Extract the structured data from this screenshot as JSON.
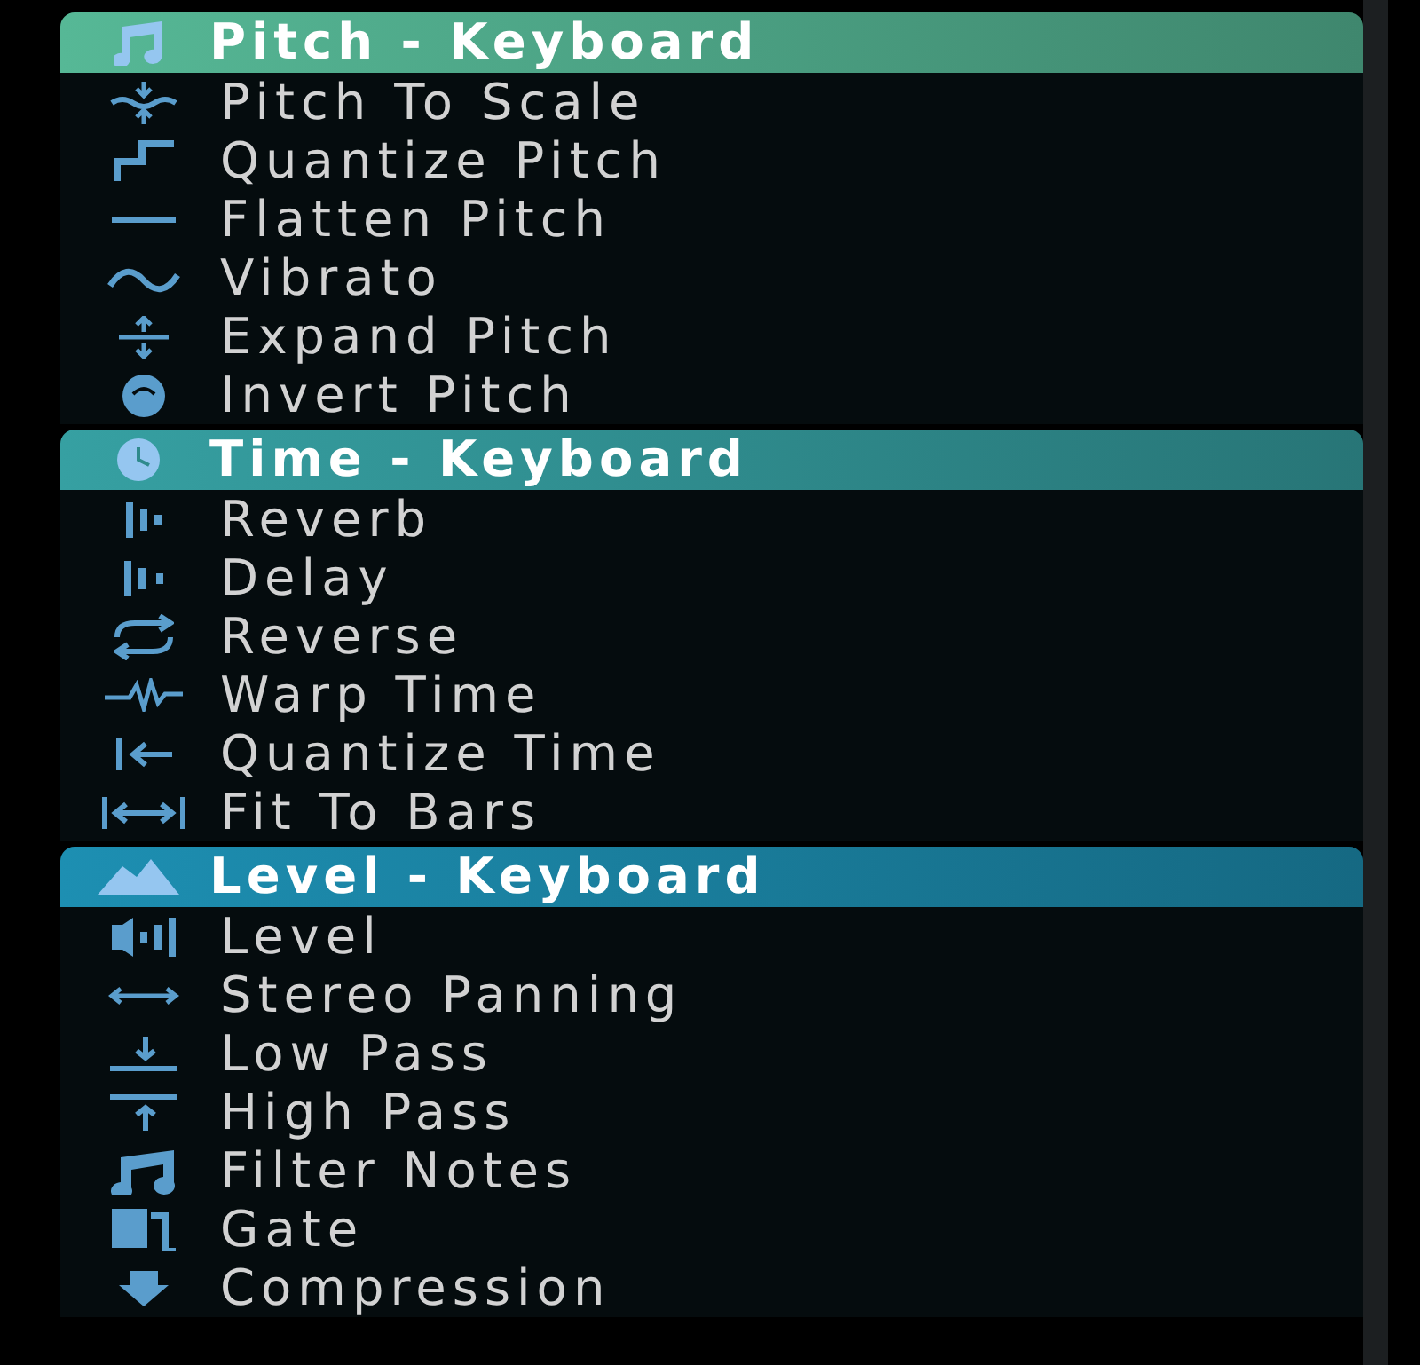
{
  "sections": [
    {
      "title": "Pitch - Keyboard",
      "color": "#56b896",
      "items": [
        "Pitch To Scale",
        "Quantize Pitch",
        "Flatten Pitch",
        "Vibrato",
        "Expand Pitch",
        "Invert Pitch"
      ]
    },
    {
      "title": "Time - Keyboard",
      "color": "#36a0a2",
      "items": [
        "Reverb",
        "Delay",
        "Reverse",
        "Warp Time",
        "Quantize Time",
        "Fit To Bars"
      ]
    },
    {
      "title": "Level - Keyboard",
      "color": "#1d8fb2",
      "items": [
        "Level",
        "Stereo Panning",
        "Low Pass",
        "High Pass",
        "Filter Notes",
        "Gate",
        "Compression"
      ]
    }
  ]
}
